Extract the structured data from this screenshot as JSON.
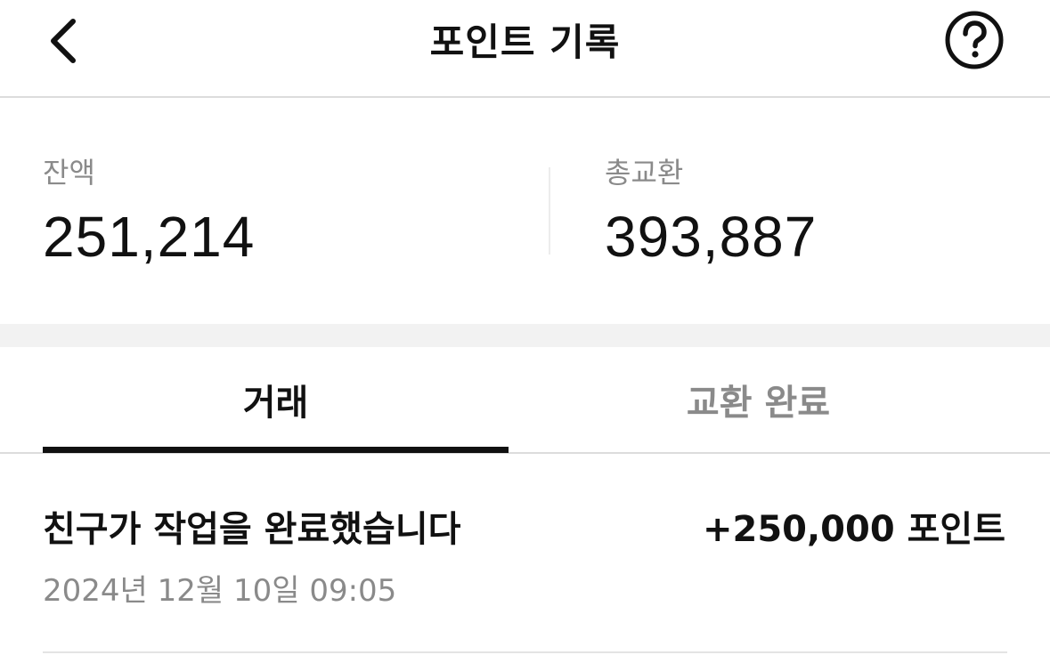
{
  "header": {
    "title": "포인트 기록",
    "back_icon": "chevron-left-icon",
    "help_icon": "question-circle-icon"
  },
  "summary": {
    "balance_label": "잔액",
    "balance_value": "251,214",
    "total_exchange_label": "총교환",
    "total_exchange_value": "393,887"
  },
  "tabs": [
    {
      "label": "거래",
      "active": true
    },
    {
      "label": "교환 완료",
      "active": false
    }
  ],
  "transactions": [
    {
      "title": "친구가 작업을 완료했습니다",
      "amount": "+250,000 포인트",
      "date": "2024년 12월 10일 09:05"
    }
  ],
  "colors": {
    "text_primary": "#111111",
    "text_secondary": "#8a8a8a",
    "divider": "#dcdcdc",
    "band": "#f2f2f2"
  }
}
